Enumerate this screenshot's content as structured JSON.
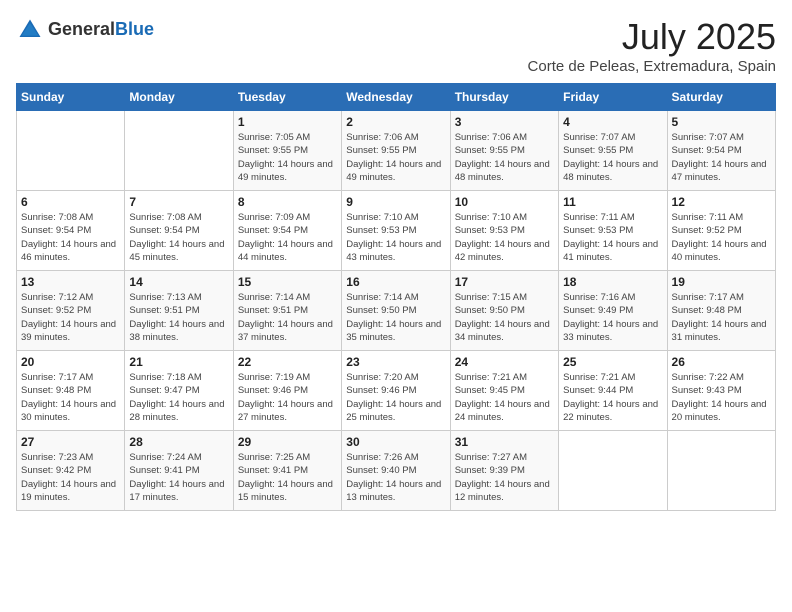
{
  "logo": {
    "general": "General",
    "blue": "Blue"
  },
  "title": "July 2025",
  "location": "Corte de Peleas, Extremadura, Spain",
  "days_of_week": [
    "Sunday",
    "Monday",
    "Tuesday",
    "Wednesday",
    "Thursday",
    "Friday",
    "Saturday"
  ],
  "weeks": [
    [
      {
        "day": "",
        "sunrise": "",
        "sunset": "",
        "daylight": ""
      },
      {
        "day": "",
        "sunrise": "",
        "sunset": "",
        "daylight": ""
      },
      {
        "day": "1",
        "sunrise": "Sunrise: 7:05 AM",
        "sunset": "Sunset: 9:55 PM",
        "daylight": "Daylight: 14 hours and 49 minutes."
      },
      {
        "day": "2",
        "sunrise": "Sunrise: 7:06 AM",
        "sunset": "Sunset: 9:55 PM",
        "daylight": "Daylight: 14 hours and 49 minutes."
      },
      {
        "day": "3",
        "sunrise": "Sunrise: 7:06 AM",
        "sunset": "Sunset: 9:55 PM",
        "daylight": "Daylight: 14 hours and 48 minutes."
      },
      {
        "day": "4",
        "sunrise": "Sunrise: 7:07 AM",
        "sunset": "Sunset: 9:55 PM",
        "daylight": "Daylight: 14 hours and 48 minutes."
      },
      {
        "day": "5",
        "sunrise": "Sunrise: 7:07 AM",
        "sunset": "Sunset: 9:54 PM",
        "daylight": "Daylight: 14 hours and 47 minutes."
      }
    ],
    [
      {
        "day": "6",
        "sunrise": "Sunrise: 7:08 AM",
        "sunset": "Sunset: 9:54 PM",
        "daylight": "Daylight: 14 hours and 46 minutes."
      },
      {
        "day": "7",
        "sunrise": "Sunrise: 7:08 AM",
        "sunset": "Sunset: 9:54 PM",
        "daylight": "Daylight: 14 hours and 45 minutes."
      },
      {
        "day": "8",
        "sunrise": "Sunrise: 7:09 AM",
        "sunset": "Sunset: 9:54 PM",
        "daylight": "Daylight: 14 hours and 44 minutes."
      },
      {
        "day": "9",
        "sunrise": "Sunrise: 7:10 AM",
        "sunset": "Sunset: 9:53 PM",
        "daylight": "Daylight: 14 hours and 43 minutes."
      },
      {
        "day": "10",
        "sunrise": "Sunrise: 7:10 AM",
        "sunset": "Sunset: 9:53 PM",
        "daylight": "Daylight: 14 hours and 42 minutes."
      },
      {
        "day": "11",
        "sunrise": "Sunrise: 7:11 AM",
        "sunset": "Sunset: 9:53 PM",
        "daylight": "Daylight: 14 hours and 41 minutes."
      },
      {
        "day": "12",
        "sunrise": "Sunrise: 7:11 AM",
        "sunset": "Sunset: 9:52 PM",
        "daylight": "Daylight: 14 hours and 40 minutes."
      }
    ],
    [
      {
        "day": "13",
        "sunrise": "Sunrise: 7:12 AM",
        "sunset": "Sunset: 9:52 PM",
        "daylight": "Daylight: 14 hours and 39 minutes."
      },
      {
        "day": "14",
        "sunrise": "Sunrise: 7:13 AM",
        "sunset": "Sunset: 9:51 PM",
        "daylight": "Daylight: 14 hours and 38 minutes."
      },
      {
        "day": "15",
        "sunrise": "Sunrise: 7:14 AM",
        "sunset": "Sunset: 9:51 PM",
        "daylight": "Daylight: 14 hours and 37 minutes."
      },
      {
        "day": "16",
        "sunrise": "Sunrise: 7:14 AM",
        "sunset": "Sunset: 9:50 PM",
        "daylight": "Daylight: 14 hours and 35 minutes."
      },
      {
        "day": "17",
        "sunrise": "Sunrise: 7:15 AM",
        "sunset": "Sunset: 9:50 PM",
        "daylight": "Daylight: 14 hours and 34 minutes."
      },
      {
        "day": "18",
        "sunrise": "Sunrise: 7:16 AM",
        "sunset": "Sunset: 9:49 PM",
        "daylight": "Daylight: 14 hours and 33 minutes."
      },
      {
        "day": "19",
        "sunrise": "Sunrise: 7:17 AM",
        "sunset": "Sunset: 9:48 PM",
        "daylight": "Daylight: 14 hours and 31 minutes."
      }
    ],
    [
      {
        "day": "20",
        "sunrise": "Sunrise: 7:17 AM",
        "sunset": "Sunset: 9:48 PM",
        "daylight": "Daylight: 14 hours and 30 minutes."
      },
      {
        "day": "21",
        "sunrise": "Sunrise: 7:18 AM",
        "sunset": "Sunset: 9:47 PM",
        "daylight": "Daylight: 14 hours and 28 minutes."
      },
      {
        "day": "22",
        "sunrise": "Sunrise: 7:19 AM",
        "sunset": "Sunset: 9:46 PM",
        "daylight": "Daylight: 14 hours and 27 minutes."
      },
      {
        "day": "23",
        "sunrise": "Sunrise: 7:20 AM",
        "sunset": "Sunset: 9:46 PM",
        "daylight": "Daylight: 14 hours and 25 minutes."
      },
      {
        "day": "24",
        "sunrise": "Sunrise: 7:21 AM",
        "sunset": "Sunset: 9:45 PM",
        "daylight": "Daylight: 14 hours and 24 minutes."
      },
      {
        "day": "25",
        "sunrise": "Sunrise: 7:21 AM",
        "sunset": "Sunset: 9:44 PM",
        "daylight": "Daylight: 14 hours and 22 minutes."
      },
      {
        "day": "26",
        "sunrise": "Sunrise: 7:22 AM",
        "sunset": "Sunset: 9:43 PM",
        "daylight": "Daylight: 14 hours and 20 minutes."
      }
    ],
    [
      {
        "day": "27",
        "sunrise": "Sunrise: 7:23 AM",
        "sunset": "Sunset: 9:42 PM",
        "daylight": "Daylight: 14 hours and 19 minutes."
      },
      {
        "day": "28",
        "sunrise": "Sunrise: 7:24 AM",
        "sunset": "Sunset: 9:41 PM",
        "daylight": "Daylight: 14 hours and 17 minutes."
      },
      {
        "day": "29",
        "sunrise": "Sunrise: 7:25 AM",
        "sunset": "Sunset: 9:41 PM",
        "daylight": "Daylight: 14 hours and 15 minutes."
      },
      {
        "day": "30",
        "sunrise": "Sunrise: 7:26 AM",
        "sunset": "Sunset: 9:40 PM",
        "daylight": "Daylight: 14 hours and 13 minutes."
      },
      {
        "day": "31",
        "sunrise": "Sunrise: 7:27 AM",
        "sunset": "Sunset: 9:39 PM",
        "daylight": "Daylight: 14 hours and 12 minutes."
      },
      {
        "day": "",
        "sunrise": "",
        "sunset": "",
        "daylight": ""
      },
      {
        "day": "",
        "sunrise": "",
        "sunset": "",
        "daylight": ""
      }
    ]
  ]
}
